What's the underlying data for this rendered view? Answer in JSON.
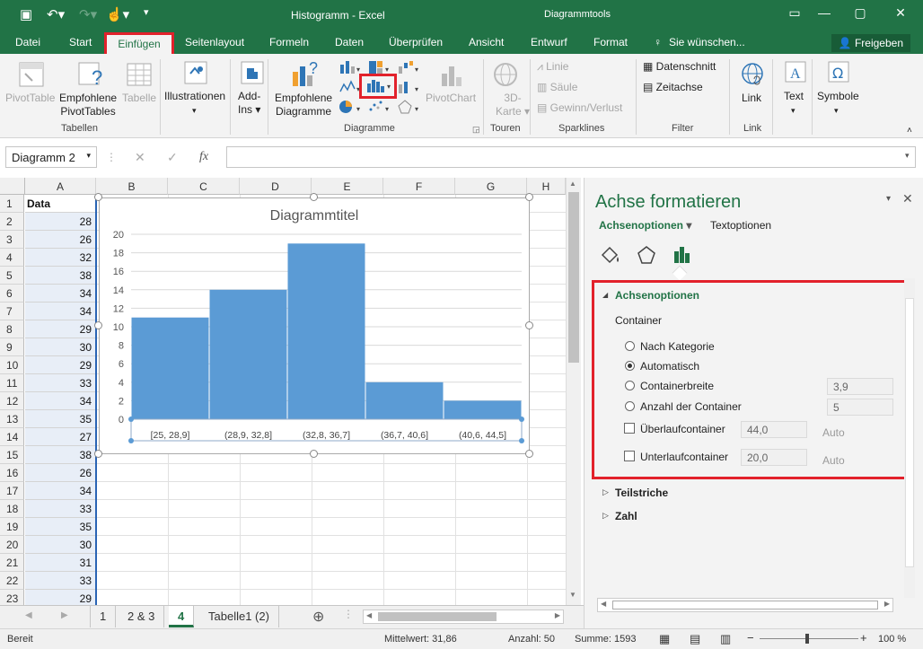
{
  "window": {
    "title": "Histogramm - Excel",
    "context_tool": "Diagrammtools",
    "minimize_icon": "minimize-icon",
    "restore_icon": "restore-icon",
    "close_icon": "close-icon"
  },
  "tabs": {
    "datei": "Datei",
    "start": "Start",
    "einfuegen": "Einfügen",
    "seitenlayout": "Seitenlayout",
    "formeln": "Formeln",
    "daten": "Daten",
    "ueberpruefen": "Überprüfen",
    "ansicht": "Ansicht",
    "entwurf": "Entwurf",
    "format": "Format",
    "tellme": "Sie wünschen...",
    "share": "Freigeben"
  },
  "ribbon": {
    "pivottable": "PivotTable",
    "empf_pivot_1": "Empfohlene",
    "empf_pivot_2": "PivotTables",
    "tabelle": "Tabelle",
    "grp_tabellen": "Tabellen",
    "illustrationen": "Illustrationen",
    "addins_1": "Add-",
    "addins_2": "Ins",
    "empf_diag_1": "Empfohlene",
    "empf_diag_2": "Diagramme",
    "pivotchart": "PivotChart",
    "grp_diagramme": "Diagramme",
    "karte_1": "3D-",
    "karte_2": "Karte",
    "grp_touren": "Touren",
    "linie": "Linie",
    "saeule": "Säule",
    "gewinn": "Gewinn/Verlust",
    "grp_sparklines": "Sparklines",
    "datenschnitt": "Datenschnitt",
    "zeitachse": "Zeitachse",
    "grp_filter": "Filter",
    "link": "Link",
    "grp_link": "Link",
    "text": "Text",
    "symbole": "Symbole"
  },
  "formula": {
    "namebox": "Diagramm 2",
    "fx": "fx",
    "value": ""
  },
  "columns": [
    "A",
    "B",
    "C",
    "D",
    "E",
    "F",
    "G",
    "H"
  ],
  "rows": [
    "1",
    "2",
    "3",
    "4",
    "5",
    "6",
    "7",
    "8",
    "9",
    "10",
    "11",
    "12",
    "13",
    "14",
    "15",
    "16",
    "17",
    "18",
    "19",
    "20",
    "21",
    "22",
    "23"
  ],
  "colA": [
    "Data",
    "28",
    "26",
    "32",
    "38",
    "34",
    "34",
    "29",
    "30",
    "29",
    "33",
    "34",
    "35",
    "27",
    "38",
    "26",
    "34",
    "33",
    "35",
    "30",
    "31",
    "33",
    "29"
  ],
  "chart_data": {
    "type": "bar",
    "title": "Diagrammtitel",
    "categories": [
      "[25, 28,9]",
      "(28,9, 32,8]",
      "(32,8, 36,7]",
      "(36,7, 40,6]",
      "(40,6, 44,5]"
    ],
    "values": [
      11,
      14,
      19,
      4,
      2
    ],
    "ylim": [
      0,
      20
    ],
    "yticks": [
      "0",
      "2",
      "4",
      "6",
      "8",
      "10",
      "12",
      "14",
      "16",
      "18",
      "20"
    ],
    "color": "#5b9bd5",
    "grid": true
  },
  "sheets": {
    "t1": "1",
    "t23": "2 & 3",
    "t4": "4",
    "tabelle1": "Tabelle1 (2)"
  },
  "pane": {
    "title": "Achse formatieren",
    "tab_axis": "Achsenoptionen",
    "tab_text": "Textoptionen",
    "section": "Achsenoptionen",
    "container": "Container",
    "r_kategorie": "Nach Kategorie",
    "r_auto": "Automatisch",
    "r_breite": "Containerbreite",
    "r_anzahl": "Anzahl der Container",
    "breite_val": "3,9",
    "anzahl_val": "5",
    "ueberlauf": "Überlaufcontainer",
    "ueberlauf_val": "44,0",
    "unterlauf": "Unterlaufcontainer",
    "unterlauf_val": "20,0",
    "auto": "Auto",
    "teilstriche": "Teilstriche",
    "zahl": "Zahl"
  },
  "status": {
    "ready": "Bereit",
    "mittelwert": "Mittelwert: 31,86",
    "anzahl": "Anzahl: 50",
    "summe": "Summe: 1593",
    "zoom": "100 %"
  },
  "accent": "#217346",
  "highlight": "#e2212b"
}
